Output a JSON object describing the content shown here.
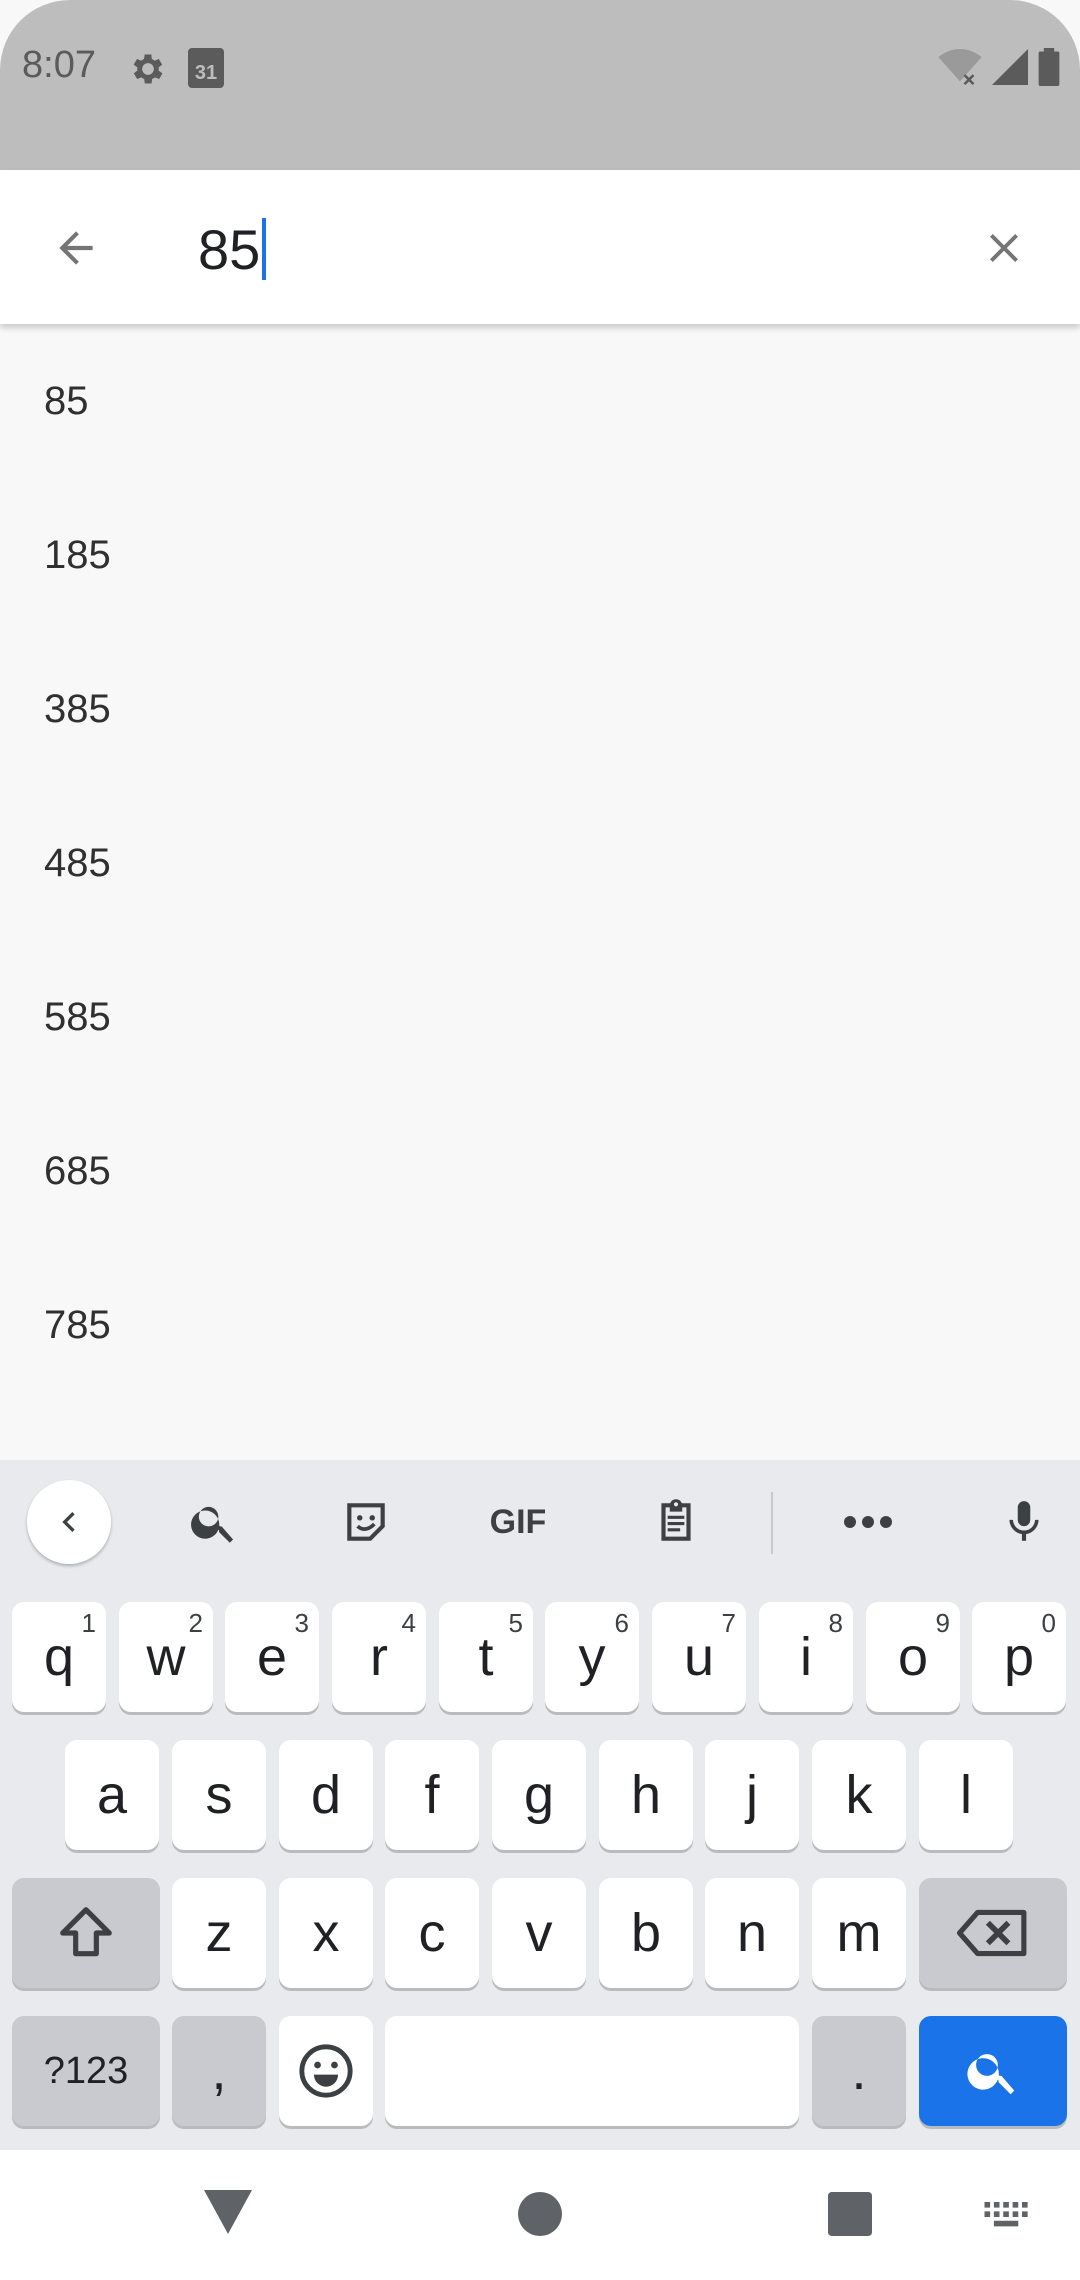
{
  "status_bar": {
    "time": "8:07",
    "calendar_day": "31",
    "icons": [
      "gear-icon",
      "calendar-icon",
      "wifi-icon",
      "signal-icon",
      "battery-icon"
    ]
  },
  "search": {
    "query": "85",
    "back_icon": "arrow-back-icon",
    "clear_icon": "close-icon"
  },
  "suggestions": [
    "85",
    "185",
    "385",
    "485",
    "585",
    "685",
    "785"
  ],
  "keyboard": {
    "toolbar": {
      "gif_label": "GIF",
      "icons": [
        "chevron-left-icon",
        "search-icon",
        "sticker-icon",
        "gif-icon",
        "clipboard-icon",
        "more-icon",
        "mic-icon"
      ]
    },
    "row1": [
      {
        "label": "q",
        "hint": "1"
      },
      {
        "label": "w",
        "hint": "2"
      },
      {
        "label": "e",
        "hint": "3"
      },
      {
        "label": "r",
        "hint": "4"
      },
      {
        "label": "t",
        "hint": "5"
      },
      {
        "label": "y",
        "hint": "6"
      },
      {
        "label": "u",
        "hint": "7"
      },
      {
        "label": "i",
        "hint": "8"
      },
      {
        "label": "o",
        "hint": "9"
      },
      {
        "label": "p",
        "hint": "0"
      }
    ],
    "row2": [
      "a",
      "s",
      "d",
      "f",
      "g",
      "h",
      "j",
      "k",
      "l"
    ],
    "row3": [
      "z",
      "x",
      "c",
      "v",
      "b",
      "n",
      "m"
    ],
    "row4": {
      "symbols": "?123",
      "comma": ",",
      "period": "."
    },
    "accent_color": "#1a73e8"
  },
  "nav_bar": {
    "icons": [
      "back-triangle-icon",
      "home-circle-icon",
      "recents-square-icon",
      "keyboard-icon"
    ]
  }
}
